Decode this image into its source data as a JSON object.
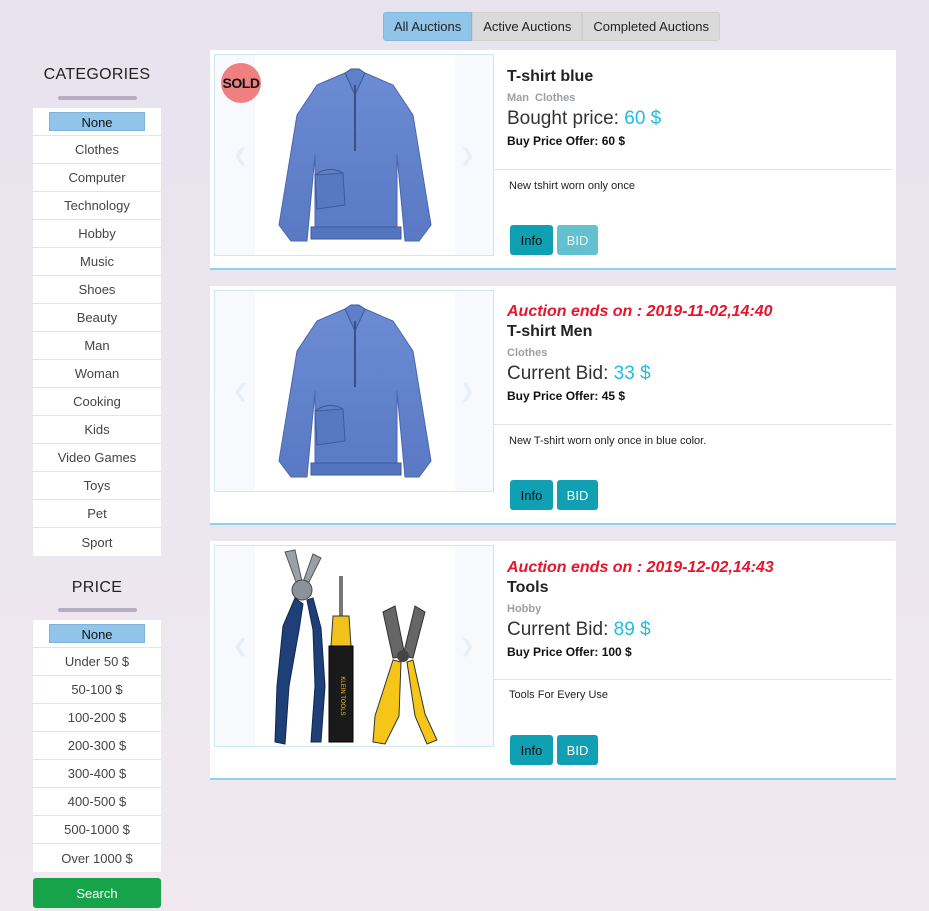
{
  "tabs": [
    {
      "label": "All Auctions",
      "active": true
    },
    {
      "label": "Active Auctions",
      "active": false
    },
    {
      "label": "Completed Auctions",
      "active": false
    }
  ],
  "sidebar": {
    "categories_title": "CATEGORIES",
    "categories": [
      "None",
      "Clothes",
      "Computer",
      "Technology",
      "Hobby",
      "Music",
      "Shoes",
      "Beauty",
      "Man",
      "Woman",
      "Cooking",
      "Kids",
      "Video Games",
      "Toys",
      "Pet",
      "Sport"
    ],
    "selected_category": "None",
    "price_title": "PRICE",
    "prices": [
      "None",
      "Under 50 $",
      "50-100 $",
      "100-200 $",
      "200-300 $",
      "300-400 $",
      "400-500 $",
      "500-1000 $",
      "Over 1000 $"
    ],
    "selected_price": "None",
    "search_label": "Search"
  },
  "auctions": [
    {
      "sold_badge": "SOLD",
      "title": "T-shirt blue",
      "tags": [
        "Man",
        "Clothes"
      ],
      "price_label": "Bought price:",
      "price_value": "60 $",
      "offer": "Buy Price Offer: 60 $",
      "description": "New tshirt worn only once",
      "info_label": "Info",
      "bid_label": "BID"
    },
    {
      "ends_on": "Auction ends on : 2019-11-02,14:40",
      "title": "T-shirt Men",
      "tags": [
        "Clothes"
      ],
      "price_label": "Current Bid:",
      "price_value": "33 $",
      "offer": "Buy Price Offer: 45 $",
      "description": "New T-shirt worn only once in blue color.",
      "info_label": "Info",
      "bid_label": "BID"
    },
    {
      "ends_on": "Auction ends on : 2019-12-02,14:43",
      "title": "Tools",
      "tags": [
        "Hobby"
      ],
      "price_label": "Current Bid:",
      "price_value": "89 $",
      "offer": "Buy Price Offer: 100 $",
      "description": "Tools For Every Use",
      "info_label": "Info",
      "bid_label": "BID"
    }
  ],
  "colors": {
    "tab_active": "#90c4e9",
    "bid_button": "#119fb3",
    "price_value": "#1fbde1",
    "ends_on": "#e8142c",
    "search_button": "#17a34a",
    "sold_badge": "#f08080"
  }
}
